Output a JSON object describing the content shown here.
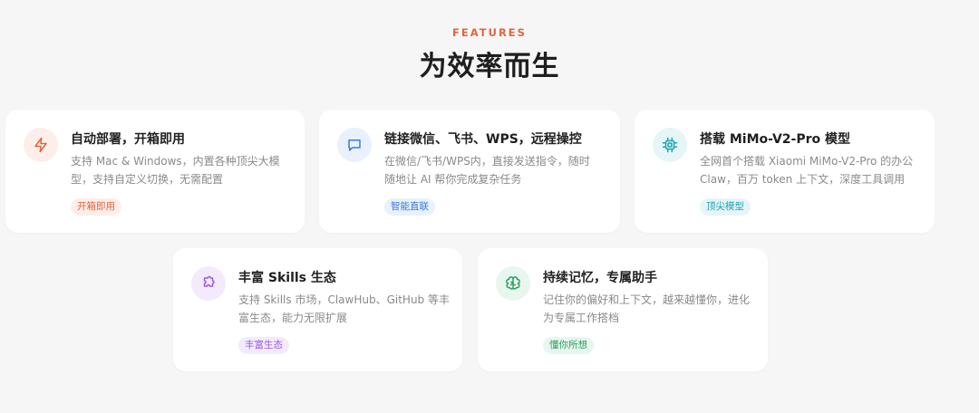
{
  "header": {
    "eyebrow": "FEATURES",
    "title": "为效率而生"
  },
  "colors": {
    "accent": "#e0663f",
    "blue": "#3a7be0",
    "cyan": "#1aa5b5",
    "purple": "#9a5ce0",
    "green": "#2e9e63"
  },
  "cards": [
    {
      "icon": "lightning-icon",
      "title": "自动部署，开箱即用",
      "description": "支持 Mac & Windows，内置各种顶尖大模型，支持自定义切换，无需配置",
      "tag": "开箱即用"
    },
    {
      "icon": "message-icon",
      "title": "链接微信、飞书、WPS，远程操控",
      "description": "在微信/飞书/WPS内，直接发送指令，随时随地让 AI 帮你完成复杂任务",
      "tag": "智能直联"
    },
    {
      "icon": "chip-icon",
      "title": "搭载 MiMo-V2-Pro 模型",
      "description": "全网首个搭载 Xiaomi MiMo-V2-Pro 的办公 Claw，百万 token 上下文，深度工具调用",
      "tag": "顶尖模型"
    },
    {
      "icon": "puzzle-icon",
      "title": "丰富 Skills 生态",
      "description": "支持 Skills 市场，ClawHub、GitHub 等丰富生态，能力无限扩展",
      "tag": "丰富生态"
    },
    {
      "icon": "brain-icon",
      "title": "持续记忆，专属助手",
      "description": "记住你的偏好和上下文，越来越懂你，进化为专属工作搭档",
      "tag": "懂你所想"
    }
  ]
}
